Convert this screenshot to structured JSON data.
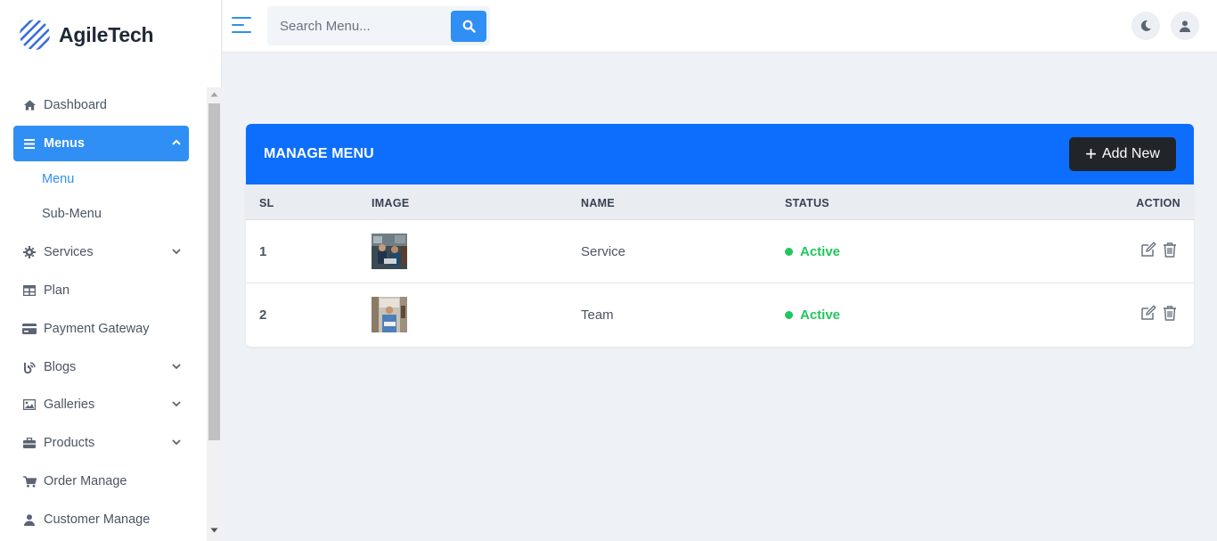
{
  "brand": {
    "name": "AgileTech"
  },
  "sidebar": {
    "items": [
      {
        "label": "Dashboard",
        "icon": "home-icon"
      },
      {
        "label": "Menus",
        "icon": "list-icon",
        "active": true
      },
      {
        "label": "Services",
        "icon": "gear-icon"
      },
      {
        "label": "Plan",
        "icon": "table-icon"
      },
      {
        "label": "Payment Gateway",
        "icon": "credit-card-icon"
      },
      {
        "label": "Blogs",
        "icon": "blog-icon"
      },
      {
        "label": "Galleries",
        "icon": "image-icon"
      },
      {
        "label": "Products",
        "icon": "briefcase-icon"
      },
      {
        "label": "Order Manage",
        "icon": "cart-icon"
      },
      {
        "label": "Customer Manage",
        "icon": "user-icon"
      }
    ],
    "sub_items": [
      {
        "label": "Menu",
        "current": true
      },
      {
        "label": "Sub-Menu"
      }
    ]
  },
  "topbar": {
    "search_placeholder": "Search Menu..."
  },
  "card": {
    "title": "MANAGE MENU",
    "add_label": "Add New",
    "columns": [
      "SL",
      "IMAGE",
      "NAME",
      "STATUS",
      "ACTION"
    ],
    "rows": [
      {
        "sl": "1",
        "name": "Service",
        "status": "Active"
      },
      {
        "sl": "2",
        "name": "Team",
        "status": "Active"
      }
    ]
  },
  "colors": {
    "accent": "#2f8ff4",
    "header": "#0d6efd",
    "status_active": "#22c55e",
    "dark_button": "#212529"
  }
}
